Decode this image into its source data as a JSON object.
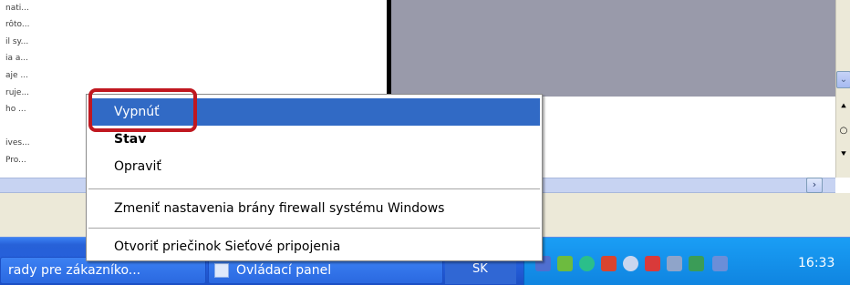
{
  "left_list": [
    "nati...",
    "rôto...",
    "il sy...",
    "ia a...",
    "aje ...",
    "ruje...",
    "ho ...",
    "ives...",
    "Pro..."
  ],
  "context_menu": {
    "items": [
      {
        "label": "Vypnúť",
        "selected": true,
        "bold": false
      },
      {
        "label": "Stav",
        "selected": false,
        "bold": true
      },
      {
        "label": "Opraviť",
        "selected": false,
        "bold": false
      },
      {
        "label": "Zmeniť nastavenia brány firewall systému Windows",
        "selected": false,
        "bold": false
      },
      {
        "label": "Otvoriť priečinok Sieťové pripojenia",
        "selected": false,
        "bold": false
      }
    ]
  },
  "taskbar": {
    "task1_label": "rady pre zákazníko...",
    "task2_label": "Ovládací panel",
    "lang": "SK",
    "clock": "16:33"
  },
  "scrollbar": {
    "down_glyph": "⌄",
    "right_glyph": "›",
    "side_glyphs": [
      "⯅",
      "○",
      "⯆"
    ]
  },
  "colors": {
    "selection": "#316ac5",
    "highlight_ring": "#c01820",
    "taskbar": "#245edb",
    "tray": "#0f84e0"
  }
}
